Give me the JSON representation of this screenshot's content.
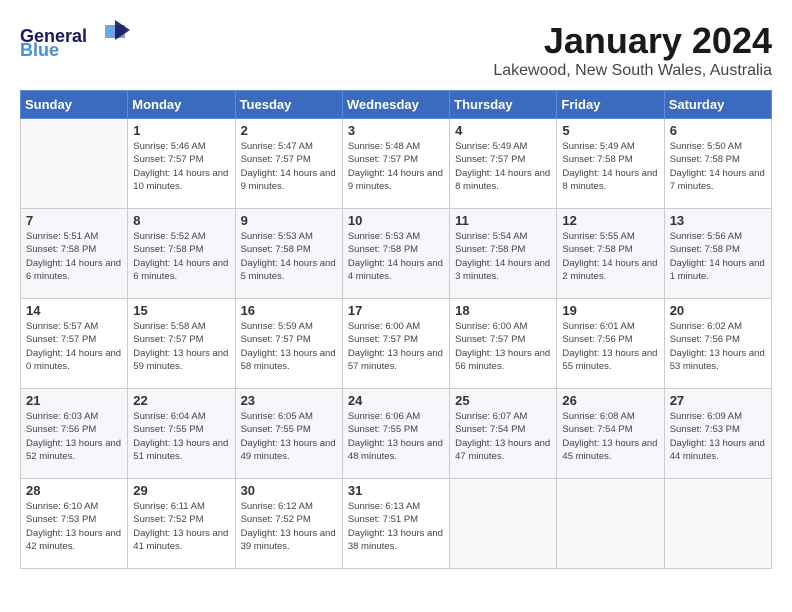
{
  "header": {
    "logo_general": "General",
    "logo_blue": "Blue",
    "month": "January 2024",
    "location": "Lakewood, New South Wales, Australia"
  },
  "weekdays": [
    "Sunday",
    "Monday",
    "Tuesday",
    "Wednesday",
    "Thursday",
    "Friday",
    "Saturday"
  ],
  "weeks": [
    [
      {
        "day": "",
        "sunrise": "",
        "sunset": "",
        "daylight": ""
      },
      {
        "day": "1",
        "sunrise": "Sunrise: 5:46 AM",
        "sunset": "Sunset: 7:57 PM",
        "daylight": "Daylight: 14 hours and 10 minutes."
      },
      {
        "day": "2",
        "sunrise": "Sunrise: 5:47 AM",
        "sunset": "Sunset: 7:57 PM",
        "daylight": "Daylight: 14 hours and 9 minutes."
      },
      {
        "day": "3",
        "sunrise": "Sunrise: 5:48 AM",
        "sunset": "Sunset: 7:57 PM",
        "daylight": "Daylight: 14 hours and 9 minutes."
      },
      {
        "day": "4",
        "sunrise": "Sunrise: 5:49 AM",
        "sunset": "Sunset: 7:57 PM",
        "daylight": "Daylight: 14 hours and 8 minutes."
      },
      {
        "day": "5",
        "sunrise": "Sunrise: 5:49 AM",
        "sunset": "Sunset: 7:58 PM",
        "daylight": "Daylight: 14 hours and 8 minutes."
      },
      {
        "day": "6",
        "sunrise": "Sunrise: 5:50 AM",
        "sunset": "Sunset: 7:58 PM",
        "daylight": "Daylight: 14 hours and 7 minutes."
      }
    ],
    [
      {
        "day": "7",
        "sunrise": "Sunrise: 5:51 AM",
        "sunset": "Sunset: 7:58 PM",
        "daylight": "Daylight: 14 hours and 6 minutes."
      },
      {
        "day": "8",
        "sunrise": "Sunrise: 5:52 AM",
        "sunset": "Sunset: 7:58 PM",
        "daylight": "Daylight: 14 hours and 6 minutes."
      },
      {
        "day": "9",
        "sunrise": "Sunrise: 5:53 AM",
        "sunset": "Sunset: 7:58 PM",
        "daylight": "Daylight: 14 hours and 5 minutes."
      },
      {
        "day": "10",
        "sunrise": "Sunrise: 5:53 AM",
        "sunset": "Sunset: 7:58 PM",
        "daylight": "Daylight: 14 hours and 4 minutes."
      },
      {
        "day": "11",
        "sunrise": "Sunrise: 5:54 AM",
        "sunset": "Sunset: 7:58 PM",
        "daylight": "Daylight: 14 hours and 3 minutes."
      },
      {
        "day": "12",
        "sunrise": "Sunrise: 5:55 AM",
        "sunset": "Sunset: 7:58 PM",
        "daylight": "Daylight: 14 hours and 2 minutes."
      },
      {
        "day": "13",
        "sunrise": "Sunrise: 5:56 AM",
        "sunset": "Sunset: 7:58 PM",
        "daylight": "Daylight: 14 hours and 1 minute."
      }
    ],
    [
      {
        "day": "14",
        "sunrise": "Sunrise: 5:57 AM",
        "sunset": "Sunset: 7:57 PM",
        "daylight": "Daylight: 14 hours and 0 minutes."
      },
      {
        "day": "15",
        "sunrise": "Sunrise: 5:58 AM",
        "sunset": "Sunset: 7:57 PM",
        "daylight": "Daylight: 13 hours and 59 minutes."
      },
      {
        "day": "16",
        "sunrise": "Sunrise: 5:59 AM",
        "sunset": "Sunset: 7:57 PM",
        "daylight": "Daylight: 13 hours and 58 minutes."
      },
      {
        "day": "17",
        "sunrise": "Sunrise: 6:00 AM",
        "sunset": "Sunset: 7:57 PM",
        "daylight": "Daylight: 13 hours and 57 minutes."
      },
      {
        "day": "18",
        "sunrise": "Sunrise: 6:00 AM",
        "sunset": "Sunset: 7:57 PM",
        "daylight": "Daylight: 13 hours and 56 minutes."
      },
      {
        "day": "19",
        "sunrise": "Sunrise: 6:01 AM",
        "sunset": "Sunset: 7:56 PM",
        "daylight": "Daylight: 13 hours and 55 minutes."
      },
      {
        "day": "20",
        "sunrise": "Sunrise: 6:02 AM",
        "sunset": "Sunset: 7:56 PM",
        "daylight": "Daylight: 13 hours and 53 minutes."
      }
    ],
    [
      {
        "day": "21",
        "sunrise": "Sunrise: 6:03 AM",
        "sunset": "Sunset: 7:56 PM",
        "daylight": "Daylight: 13 hours and 52 minutes."
      },
      {
        "day": "22",
        "sunrise": "Sunrise: 6:04 AM",
        "sunset": "Sunset: 7:55 PM",
        "daylight": "Daylight: 13 hours and 51 minutes."
      },
      {
        "day": "23",
        "sunrise": "Sunrise: 6:05 AM",
        "sunset": "Sunset: 7:55 PM",
        "daylight": "Daylight: 13 hours and 49 minutes."
      },
      {
        "day": "24",
        "sunrise": "Sunrise: 6:06 AM",
        "sunset": "Sunset: 7:55 PM",
        "daylight": "Daylight: 13 hours and 48 minutes."
      },
      {
        "day": "25",
        "sunrise": "Sunrise: 6:07 AM",
        "sunset": "Sunset: 7:54 PM",
        "daylight": "Daylight: 13 hours and 47 minutes."
      },
      {
        "day": "26",
        "sunrise": "Sunrise: 6:08 AM",
        "sunset": "Sunset: 7:54 PM",
        "daylight": "Daylight: 13 hours and 45 minutes."
      },
      {
        "day": "27",
        "sunrise": "Sunrise: 6:09 AM",
        "sunset": "Sunset: 7:53 PM",
        "daylight": "Daylight: 13 hours and 44 minutes."
      }
    ],
    [
      {
        "day": "28",
        "sunrise": "Sunrise: 6:10 AM",
        "sunset": "Sunset: 7:53 PM",
        "daylight": "Daylight: 13 hours and 42 minutes."
      },
      {
        "day": "29",
        "sunrise": "Sunrise: 6:11 AM",
        "sunset": "Sunset: 7:52 PM",
        "daylight": "Daylight: 13 hours and 41 minutes."
      },
      {
        "day": "30",
        "sunrise": "Sunrise: 6:12 AM",
        "sunset": "Sunset: 7:52 PM",
        "daylight": "Daylight: 13 hours and 39 minutes."
      },
      {
        "day": "31",
        "sunrise": "Sunrise: 6:13 AM",
        "sunset": "Sunset: 7:51 PM",
        "daylight": "Daylight: 13 hours and 38 minutes."
      },
      {
        "day": "",
        "sunrise": "",
        "sunset": "",
        "daylight": ""
      },
      {
        "day": "",
        "sunrise": "",
        "sunset": "",
        "daylight": ""
      },
      {
        "day": "",
        "sunrise": "",
        "sunset": "",
        "daylight": ""
      }
    ]
  ]
}
